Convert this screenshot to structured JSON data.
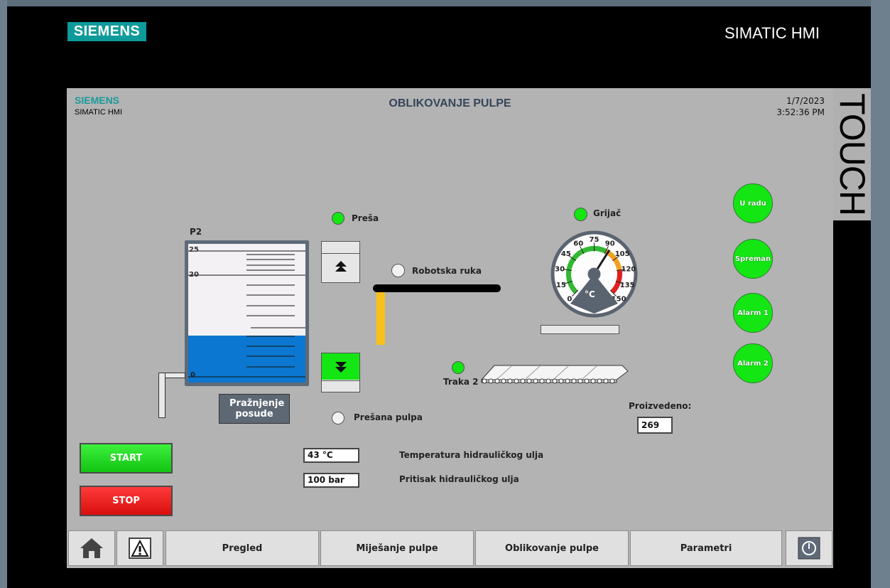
{
  "bezel": {
    "logo": "SIEMENS",
    "product": "SIMATIC HMI",
    "touch_label": "TOUCH"
  },
  "header": {
    "brand": "SIEMENS",
    "brand_sub": "SIMATIC HMI",
    "title": "OBLIKOVANJE PULPE",
    "date": "1/7/2023",
    "time": "3:52:36 PM"
  },
  "tank": {
    "label": "P2",
    "scale_top": "25",
    "scale_mid": "20",
    "scale_bottom": "0",
    "level_fraction": 0.34,
    "color": "#0b77d0",
    "empty_button": "Pražnjenje posude"
  },
  "indicators": {
    "presa": {
      "label": "Preša",
      "state": "on"
    },
    "robotska_ruka": {
      "label": "Robotska ruka",
      "state": "off"
    },
    "grijac": {
      "label": "Grijač",
      "state": "on"
    },
    "traka2": {
      "label": "Traka 2",
      "state": "on"
    },
    "presana_pulpa": {
      "label": "Prešana pulpa",
      "state": "off"
    }
  },
  "gauge": {
    "unit": "°C",
    "ticks": [
      "0",
      "15",
      "30",
      "45",
      "60",
      "75",
      "90",
      "105",
      "120",
      "135",
      "150"
    ],
    "value": 43,
    "min": 0,
    "max": 150
  },
  "status_leds": [
    "U radu",
    "Spreman",
    "Alarm 1",
    "Alarm 2"
  ],
  "produced": {
    "label": "Proizvedeno:",
    "value": "269"
  },
  "fields": {
    "temp_value": "43 °C",
    "temp_label": "Temperatura hidrauličkog ulja",
    "pressure_value": "100 bar",
    "pressure_label": "Pritisak hidrauličkog ulja"
  },
  "controls": {
    "start": "START",
    "stop": "STOP"
  },
  "nav": {
    "home_icon": "home-icon",
    "alarm_icon": "warning-icon",
    "tabs": [
      "Pregled",
      "Miješanje pulpe",
      "Oblikovanje pulpe",
      "Parametri"
    ],
    "power_icon": "power-icon"
  },
  "colors": {
    "screen_bg": "#b3b3b3",
    "brand": "#0e9a9a",
    "led_on": "#14e614",
    "start": "#22d822",
    "stop": "#e01414"
  }
}
